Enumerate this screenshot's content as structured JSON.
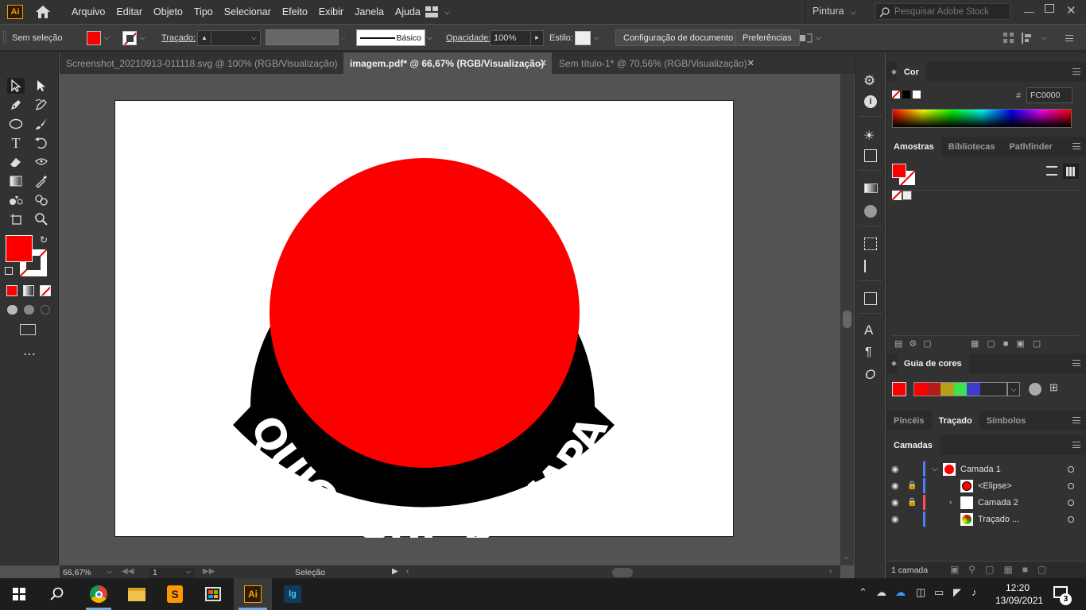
{
  "app": {
    "logo": "Ai",
    "workspace": "Pintura",
    "search_placeholder": "Pesquisar Adobe Stock"
  },
  "menu": [
    "Arquivo",
    "Editar",
    "Objeto",
    "Tipo",
    "Selecionar",
    "Efeito",
    "Exibir",
    "Janela",
    "Ajuda"
  ],
  "control": {
    "selection": "Sem seleção",
    "stroke_label": "Traçado:",
    "brush_style": "Básico",
    "opacity_label": "Opacidade:",
    "opacity_value": "100%",
    "style_label": "Estilo:",
    "doc_setup": "Configuração de documento",
    "preferences": "Preferências"
  },
  "tabs": [
    {
      "label": "Screenshot_20210913-011118.svg @ 100% (RGB/Visualização)",
      "active": false
    },
    {
      "label": "imagem.pdf* @ 66,67% (RGB/Visualização)",
      "active": true
    },
    {
      "label": "Sem título-1* @ 70,56% (RGB/Visualização)",
      "active": false
    }
  ],
  "artwork": {
    "logo_text": "QUIOSQUE DO JAPA",
    "fill": "#FC0000"
  },
  "status": {
    "zoom": "66,67%",
    "artboard": "1",
    "tool": "Seleção"
  },
  "color_panel": {
    "title": "Cor",
    "hex_label": "#",
    "hex": "FC0000"
  },
  "swatch_panel": {
    "tabs": [
      "Amostras",
      "Bibliotecas",
      "Pathfinder"
    ]
  },
  "color_guide": {
    "title": "Guia de cores"
  },
  "brush_panel": {
    "tabs": [
      "Pincéis",
      "Traçado",
      "Símbolos"
    ]
  },
  "layers_panel": {
    "title": "Camadas",
    "layers": [
      {
        "name": "Camada 1",
        "level": 0,
        "expanded": true,
        "locked": false,
        "color": "#4f7bff"
      },
      {
        "name": "<Elipse>",
        "level": 1,
        "locked": true,
        "color": "#4f7bff"
      },
      {
        "name": "Camada 2",
        "level": 1,
        "locked": true,
        "color": "#ff4f4f"
      },
      {
        "name": "Traçado ...",
        "level": 1,
        "locked": false,
        "color": "#4f7bff"
      }
    ],
    "footer": "1 camada"
  },
  "taskbar": {
    "time": "12:20",
    "date": "13/09/2021",
    "notif_count": "3"
  },
  "colors": {
    "accent_red": "#FC0000",
    "ui_dark": "#323232",
    "canvas": "#535353"
  }
}
